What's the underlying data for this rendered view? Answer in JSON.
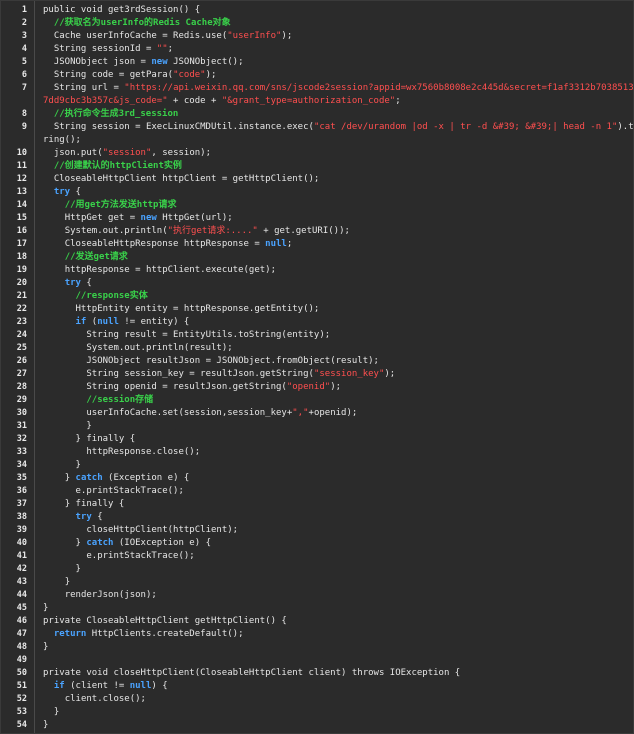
{
  "lines": [
    {
      "n": "1",
      "indent": "",
      "parts": [
        {
          "t": "public void get3rdSession() {",
          "c": "pl"
        }
      ]
    },
    {
      "n": "2",
      "indent": "  ",
      "parts": [
        {
          "t": "//获取名为userInfo的Redis Cache对象",
          "c": "cm"
        }
      ]
    },
    {
      "n": "3",
      "indent": "  ",
      "parts": [
        {
          "t": "Cache userInfoCache = Redis.use(",
          "c": "pl"
        },
        {
          "t": "\"userInfo\"",
          "c": "str"
        },
        {
          "t": ");",
          "c": "pl"
        }
      ]
    },
    {
      "n": "4",
      "indent": "  ",
      "parts": [
        {
          "t": "String sessionId = ",
          "c": "pl"
        },
        {
          "t": "\"\"",
          "c": "str"
        },
        {
          "t": ";",
          "c": "pl"
        }
      ]
    },
    {
      "n": "5",
      "indent": "  ",
      "parts": [
        {
          "t": "JSONObject json = ",
          "c": "pl"
        },
        {
          "t": "new",
          "c": "kw"
        },
        {
          "t": " JSONObject();",
          "c": "pl"
        }
      ]
    },
    {
      "n": "6",
      "indent": "  ",
      "parts": [
        {
          "t": "String code = getPara(",
          "c": "pl"
        },
        {
          "t": "\"code\"",
          "c": "str"
        },
        {
          "t": ");",
          "c": "pl"
        }
      ]
    },
    {
      "n": "7",
      "indent": "  ",
      "parts": [
        {
          "t": "String url = ",
          "c": "pl"
        },
        {
          "t": "\"https://api.weixin.qq.com/sns/jscode2session?appid=wx7560b8008e2c445d&secret=f1af3312b7038513fd1",
          "c": "str"
        }
      ]
    },
    {
      "n": "",
      "indent": "",
      "parts": [
        {
          "t": "7dd9cbc3b357c&js_code=\"",
          "c": "str"
        },
        {
          "t": " + code + ",
          "c": "pl"
        },
        {
          "t": "\"&grant_type=authorization_code\"",
          "c": "str"
        },
        {
          "t": ";",
          "c": "pl"
        }
      ]
    },
    {
      "n": "8",
      "indent": "  ",
      "parts": [
        {
          "t": "//执行命令生成3rd_session",
          "c": "cm"
        }
      ]
    },
    {
      "n": "9",
      "indent": "  ",
      "parts": [
        {
          "t": "String session = ExecLinuxCMDUtil.instance.exec(",
          "c": "pl"
        },
        {
          "t": "\"cat /dev/urandom |od -x | tr -d &#39; &#39;| head -n 1\"",
          "c": "str"
        },
        {
          "t": ").toSt",
          "c": "pl"
        }
      ]
    },
    {
      "n": "",
      "indent": "",
      "parts": [
        {
          "t": "ring();",
          "c": "pl"
        }
      ]
    },
    {
      "n": "10",
      "indent": "  ",
      "parts": [
        {
          "t": "json.put(",
          "c": "pl"
        },
        {
          "t": "\"session\"",
          "c": "str"
        },
        {
          "t": ", session);",
          "c": "pl"
        }
      ]
    },
    {
      "n": "11",
      "indent": "  ",
      "parts": [
        {
          "t": "//创建默认的httpClient实例",
          "c": "cm"
        }
      ]
    },
    {
      "n": "12",
      "indent": "  ",
      "parts": [
        {
          "t": "CloseableHttpClient httpClient = getHttpClient();",
          "c": "pl"
        }
      ]
    },
    {
      "n": "13",
      "indent": "  ",
      "parts": [
        {
          "t": "try",
          "c": "kw"
        },
        {
          "t": " {",
          "c": "pl"
        }
      ]
    },
    {
      "n": "14",
      "indent": "    ",
      "parts": [
        {
          "t": "//用get方法发送http请求",
          "c": "cm"
        }
      ]
    },
    {
      "n": "15",
      "indent": "    ",
      "parts": [
        {
          "t": "HttpGet get = ",
          "c": "pl"
        },
        {
          "t": "new",
          "c": "kw"
        },
        {
          "t": " HttpGet(url);",
          "c": "pl"
        }
      ]
    },
    {
      "n": "16",
      "indent": "    ",
      "parts": [
        {
          "t": "System.out.println(",
          "c": "pl"
        },
        {
          "t": "\"执行get请求:....\"",
          "c": "str"
        },
        {
          "t": " + get.getURI());",
          "c": "pl"
        }
      ]
    },
    {
      "n": "17",
      "indent": "    ",
      "parts": [
        {
          "t": "CloseableHttpResponse httpResponse = ",
          "c": "pl"
        },
        {
          "t": "null",
          "c": "kw"
        },
        {
          "t": ";",
          "c": "pl"
        }
      ]
    },
    {
      "n": "18",
      "indent": "    ",
      "parts": [
        {
          "t": "//发送get请求",
          "c": "cm"
        }
      ]
    },
    {
      "n": "19",
      "indent": "    ",
      "parts": [
        {
          "t": "httpResponse = httpClient.execute(get);",
          "c": "pl"
        }
      ]
    },
    {
      "n": "20",
      "indent": "    ",
      "parts": [
        {
          "t": "try",
          "c": "kw"
        },
        {
          "t": " {",
          "c": "pl"
        }
      ]
    },
    {
      "n": "21",
      "indent": "      ",
      "parts": [
        {
          "t": "//response实体",
          "c": "cm"
        }
      ]
    },
    {
      "n": "22",
      "indent": "      ",
      "parts": [
        {
          "t": "HttpEntity entity = httpResponse.getEntity();",
          "c": "pl"
        }
      ]
    },
    {
      "n": "23",
      "indent": "      ",
      "parts": [
        {
          "t": "if",
          "c": "kw"
        },
        {
          "t": " (",
          "c": "pl"
        },
        {
          "t": "null",
          "c": "kw"
        },
        {
          "t": " != entity) {",
          "c": "pl"
        }
      ]
    },
    {
      "n": "24",
      "indent": "        ",
      "parts": [
        {
          "t": "String result = EntityUtils.toString(entity);",
          "c": "pl"
        }
      ]
    },
    {
      "n": "25",
      "indent": "        ",
      "parts": [
        {
          "t": "System.out.println(result);",
          "c": "pl"
        }
      ]
    },
    {
      "n": "26",
      "indent": "        ",
      "parts": [
        {
          "t": "JSONObject resultJson = JSONObject.fromObject(result);",
          "c": "pl"
        }
      ]
    },
    {
      "n": "27",
      "indent": "        ",
      "parts": [
        {
          "t": "String session_key = resultJson.getString(",
          "c": "pl"
        },
        {
          "t": "\"session_key\"",
          "c": "str"
        },
        {
          "t": ");",
          "c": "pl"
        }
      ]
    },
    {
      "n": "28",
      "indent": "        ",
      "parts": [
        {
          "t": "String openid = resultJson.getString(",
          "c": "pl"
        },
        {
          "t": "\"openid\"",
          "c": "str"
        },
        {
          "t": ");",
          "c": "pl"
        }
      ]
    },
    {
      "n": "29",
      "indent": "        ",
      "parts": [
        {
          "t": "//session存储",
          "c": "cm"
        }
      ]
    },
    {
      "n": "30",
      "indent": "        ",
      "parts": [
        {
          "t": "userInfoCache.set(session,session_key+",
          "c": "pl"
        },
        {
          "t": "\",\"",
          "c": "str"
        },
        {
          "t": "+openid);",
          "c": "pl"
        }
      ]
    },
    {
      "n": "31",
      "indent": "        ",
      "parts": [
        {
          "t": "}",
          "c": "pl"
        }
      ]
    },
    {
      "n": "32",
      "indent": "      ",
      "parts": [
        {
          "t": "} finally {",
          "c": "pl"
        }
      ]
    },
    {
      "n": "33",
      "indent": "        ",
      "parts": [
        {
          "t": "httpResponse.close();",
          "c": "pl"
        }
      ]
    },
    {
      "n": "34",
      "indent": "      ",
      "parts": [
        {
          "t": "}",
          "c": "pl"
        }
      ]
    },
    {
      "n": "35",
      "indent": "    ",
      "parts": [
        {
          "t": "} ",
          "c": "pl"
        },
        {
          "t": "catch",
          "c": "kw"
        },
        {
          "t": " (Exception e) {",
          "c": "pl"
        }
      ]
    },
    {
      "n": "36",
      "indent": "      ",
      "parts": [
        {
          "t": "e.printStackTrace();",
          "c": "pl"
        }
      ]
    },
    {
      "n": "37",
      "indent": "    ",
      "parts": [
        {
          "t": "} finally {",
          "c": "pl"
        }
      ]
    },
    {
      "n": "38",
      "indent": "      ",
      "parts": [
        {
          "t": "try",
          "c": "kw"
        },
        {
          "t": " {",
          "c": "pl"
        }
      ]
    },
    {
      "n": "39",
      "indent": "        ",
      "parts": [
        {
          "t": "closeHttpClient(httpClient);",
          "c": "pl"
        }
      ]
    },
    {
      "n": "40",
      "indent": "      ",
      "parts": [
        {
          "t": "} ",
          "c": "pl"
        },
        {
          "t": "catch",
          "c": "kw"
        },
        {
          "t": " (IOException e) {",
          "c": "pl"
        }
      ]
    },
    {
      "n": "41",
      "indent": "        ",
      "parts": [
        {
          "t": "e.printStackTrace();",
          "c": "pl"
        }
      ]
    },
    {
      "n": "42",
      "indent": "      ",
      "parts": [
        {
          "t": "}",
          "c": "pl"
        }
      ]
    },
    {
      "n": "43",
      "indent": "    ",
      "parts": [
        {
          "t": "}",
          "c": "pl"
        }
      ]
    },
    {
      "n": "44",
      "indent": "    ",
      "parts": [
        {
          "t": "renderJson(json);",
          "c": "pl"
        }
      ]
    },
    {
      "n": "45",
      "indent": "",
      "parts": [
        {
          "t": "}",
          "c": "pl"
        }
      ]
    },
    {
      "n": "46",
      "indent": "",
      "parts": [
        {
          "t": "private CloseableHttpClient getHttpClient() {",
          "c": "pl"
        }
      ]
    },
    {
      "n": "47",
      "indent": "  ",
      "parts": [
        {
          "t": "return",
          "c": "kw"
        },
        {
          "t": " HttpClients.createDefault();",
          "c": "pl"
        }
      ]
    },
    {
      "n": "48",
      "indent": "",
      "parts": [
        {
          "t": "}",
          "c": "pl"
        }
      ]
    },
    {
      "n": "49",
      "indent": "",
      "parts": []
    },
    {
      "n": "50",
      "indent": "",
      "parts": [
        {
          "t": "private void closeHttpClient(CloseableHttpClient client) throws IOException {",
          "c": "pl"
        }
      ]
    },
    {
      "n": "51",
      "indent": "  ",
      "parts": [
        {
          "t": "if",
          "c": "kw"
        },
        {
          "t": " (client != ",
          "c": "pl"
        },
        {
          "t": "null",
          "c": "kw"
        },
        {
          "t": ") {",
          "c": "pl"
        }
      ]
    },
    {
      "n": "52",
      "indent": "    ",
      "parts": [
        {
          "t": "client.close();",
          "c": "pl"
        }
      ]
    },
    {
      "n": "53",
      "indent": "  ",
      "parts": [
        {
          "t": "}",
          "c": "pl"
        }
      ]
    },
    {
      "n": "54",
      "indent": "",
      "parts": [
        {
          "t": "}",
          "c": "pl"
        }
      ]
    }
  ]
}
